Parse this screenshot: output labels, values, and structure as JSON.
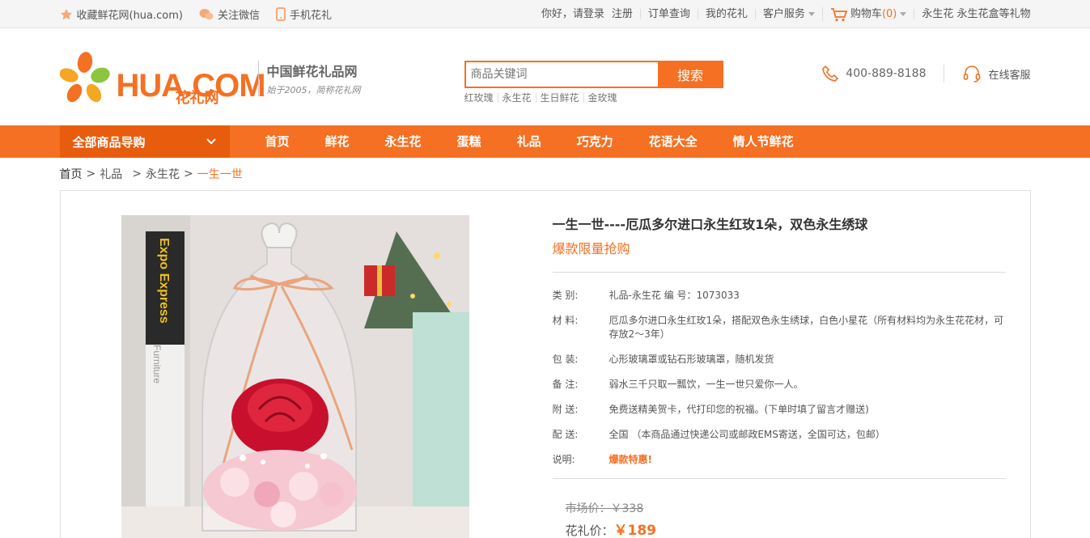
{
  "topbar": {
    "left": [
      {
        "icon": "star-icon",
        "label": "收藏鲜花网(hua.com)"
      },
      {
        "icon": "wechat-icon",
        "label": "关注微信"
      },
      {
        "icon": "phone-icon",
        "label": "手机花礼"
      }
    ],
    "greeting": "你好，请登录",
    "register": "注册",
    "order_query": "订单查询",
    "my_hua": "我的花礼",
    "customer_service": "客户服务",
    "cart_label": "购物车",
    "cart_count": "(0)",
    "promo": "永生花 永生花盒等礼物"
  },
  "header": {
    "logo_text": "HUA.COM",
    "logo_cn": "花礼网",
    "slogan": "中国鲜花礼品网",
    "slogan_sub": "始于2005，简称花礼网",
    "search_placeholder": "商品关键词",
    "search_button": "搜索",
    "hotwords": [
      "红玫瑰",
      "永生花",
      "生日鲜花",
      "金玫瑰"
    ],
    "phone": "400-889-8188",
    "online_service": "在线客服"
  },
  "nav": {
    "all_categories": "全部商品导购",
    "items": [
      "首页",
      "鲜花",
      "永生花",
      "蛋糕",
      "礼品",
      "巧克力",
      "花语大全",
      "情人节鲜花"
    ]
  },
  "breadcrumb": {
    "home": "首页",
    "level1": "礼品",
    "level2": "永生花",
    "current": "一生一世"
  },
  "product": {
    "title": "一生一世----厄瓜多尔进口永生红玫1朵，双色永生绣球",
    "subtitle": "爆款限量抢购",
    "props": [
      {
        "k": "类  别:",
        "v": "礼品-永生花 编 号：1073033"
      },
      {
        "k": "材  料:",
        "v": "厄瓜多尔进口永生红玫1朵，搭配双色永生绣球，白色小星花（所有材料均为永生花花材，可存放2～3年）"
      },
      {
        "k": "包  装:",
        "v": "心形玻璃罩或钻石形玻璃罩，随机发货"
      },
      {
        "k": "备  注:",
        "v": "弱水三千只取一瓢饮，一生一世只爱你一人。"
      },
      {
        "k": "附  送:",
        "v": "免费送精美贺卡，代打印您的祝福。(下单时填了留言才赠送)"
      },
      {
        "k": "配  送:",
        "v": "全国 （本商品通过快递公司或邮政EMS寄送，全国可达，包邮）"
      },
      {
        "k": "说明:",
        "v": "爆款特惠!",
        "highlight": true
      }
    ],
    "market_price_label": "市场价：",
    "market_price": "￥338",
    "hua_price_label": "花礼价：",
    "hua_price": "￥189",
    "photo_label": "Expo Express",
    "photo_label2": "Furniture"
  },
  "colors": {
    "accent": "#f57022",
    "accent_dark": "#e85d0d"
  }
}
